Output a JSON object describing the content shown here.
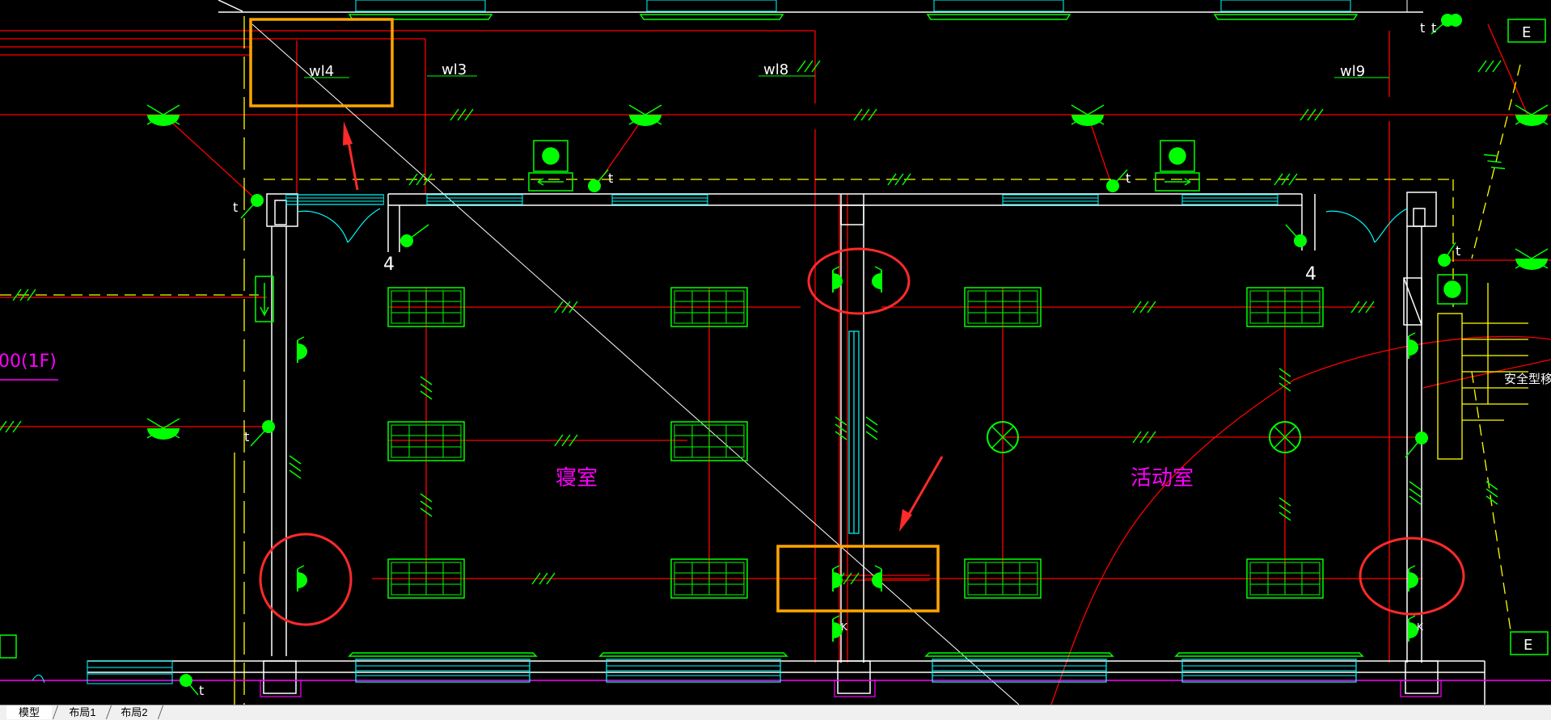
{
  "drawing": {
    "circuit_labels": [
      "wl4",
      "wl3",
      "wl8",
      "wl9"
    ],
    "room_labels": [
      "寝室",
      "活动室"
    ],
    "level_label": "00(1F)",
    "right_note": "安全型移",
    "switch_marks": [
      "t",
      "t",
      "t",
      "t",
      "t",
      "t",
      "t",
      "t"
    ],
    "socket_mark": "K",
    "count_marks": [
      "4",
      "4"
    ],
    "elevator_marks": [
      "E",
      "E"
    ],
    "colors": {
      "background": "#000000",
      "wire": "#ff0000",
      "device": "#00ff00",
      "wall": "#ffffff",
      "window": "#00ffff",
      "dashed": "#ffff00",
      "text_magenta": "#ff00ff",
      "highlight_box": "#ffa500",
      "highlight_circle": "#ff2a2a"
    }
  },
  "tabs": [
    "模型",
    "布局1",
    "布局2"
  ]
}
